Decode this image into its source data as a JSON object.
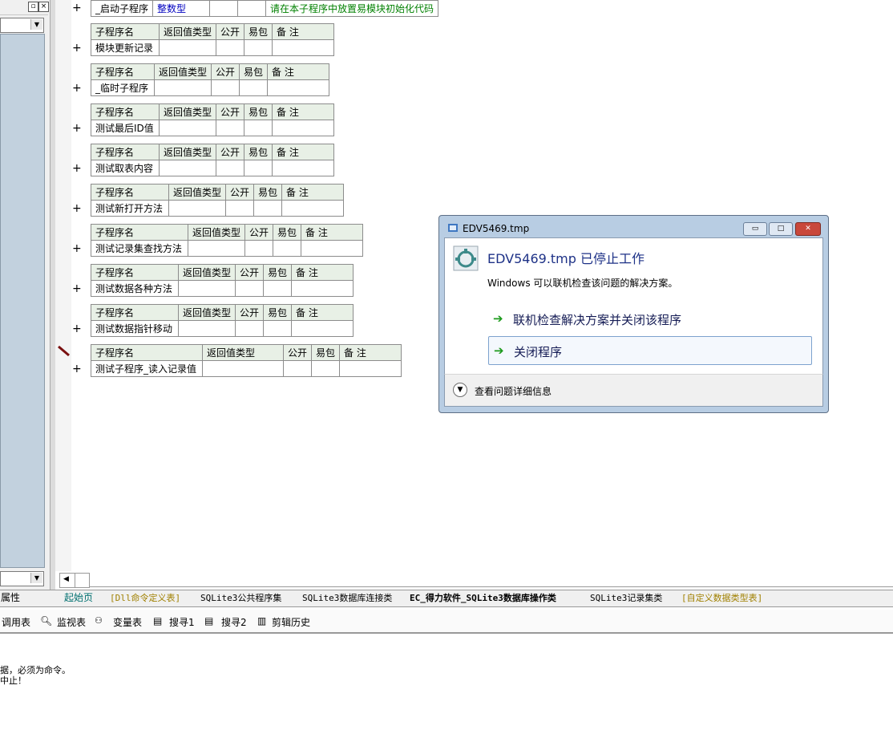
{
  "left_panel": {
    "properties_tab": "属性"
  },
  "editor": {
    "first_row": {
      "name": "_启动子程序",
      "type": "整数型",
      "note": "请在本子程序中放置易模块初始化代码"
    },
    "header": {
      "name": "子程序名",
      "return_type": "返回值类型",
      "public": "公开",
      "easy_pkg": "易包",
      "note": "备 注"
    },
    "subroutines": [
      "模块更新记录",
      "_临时子程序",
      "测试最后ID值",
      "测试取表内容",
      "测试新打开方法",
      "测试记录集查找方法",
      "测试数据各种方法",
      "测试数据指针移动",
      "测试子程序_读入记录值"
    ],
    "plus": "+"
  },
  "tabs": [
    {
      "label": "起始页",
      "color": "#007070"
    },
    {
      "label": "[Dll命令定义表]",
      "color": "#a08000"
    },
    {
      "label": "SQLite3公共程序集",
      "color": "#000000"
    },
    {
      "label": "SQLite3数据库连接类",
      "color": "#000000"
    },
    {
      "label": "EC_得力软件_SQLite3数据库操作类",
      "color": "#000000"
    },
    {
      "label": "SQLite3记录集类",
      "color": "#000000"
    },
    {
      "label": "[自定义数据类型表]",
      "color": "#a08000"
    }
  ],
  "toolbar": {
    "items": [
      "调用表",
      "监视表",
      "变量表",
      "搜寻1",
      "搜寻2",
      "剪辑历史"
    ]
  },
  "output": {
    "lines": [
      "据，必须为命令。",
      "中止！"
    ]
  },
  "dialog": {
    "title": "EDV5469.tmp",
    "heading": "EDV5469.tmp 已停止工作",
    "description": "Windows 可以联机检查该问题的解决方案。",
    "option1": "联机检查解决方案并关闭该程序",
    "option2": "关闭程序",
    "details": "查看问题详细信息",
    "close_glyph": "✕",
    "min_glyph": "▭",
    "max_glyph": "□"
  },
  "colors": {
    "dialog_frame": "#b8cde3",
    "heading": "#1e3287",
    "arrow": "#1c9a1c",
    "table_header": "#e8f0e6"
  }
}
